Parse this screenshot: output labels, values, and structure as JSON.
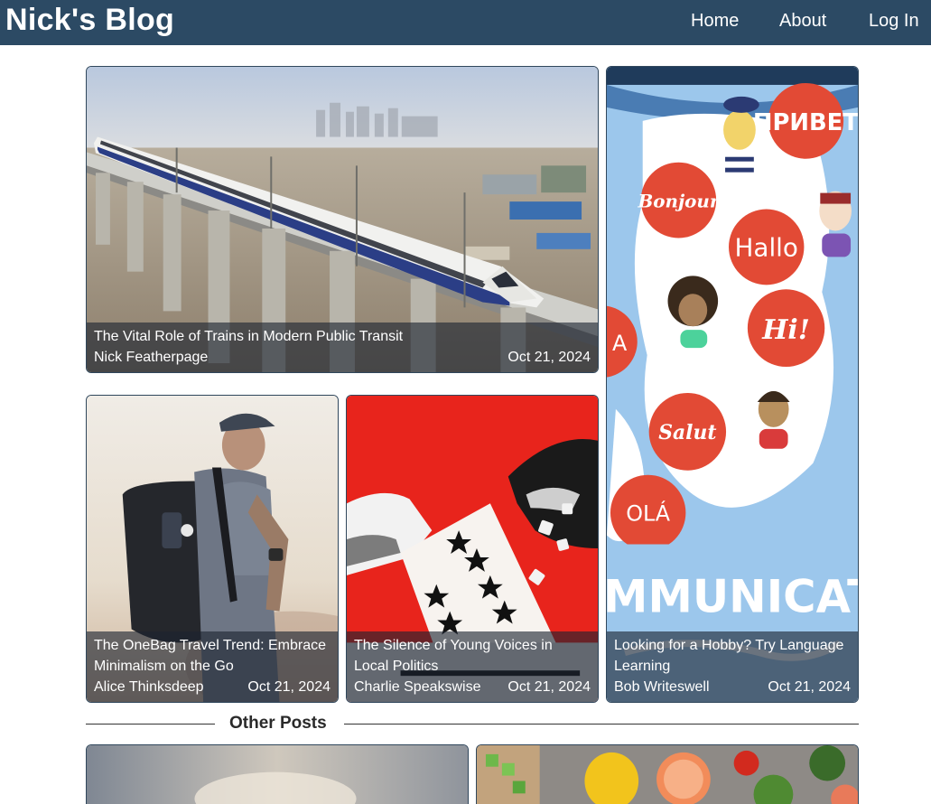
{
  "site": {
    "brand": "Nick's Blog"
  },
  "nav": {
    "home": "Home",
    "about": "About",
    "login": "Log In"
  },
  "featured": {
    "main": {
      "title": "The Vital Role of Trains in Modern Public Transit",
      "author": "Nick Featherpage",
      "date": "Oct 21, 2024"
    },
    "travel": {
      "title": "The OneBag Travel Trend: Embrace Minimalism on the Go",
      "author": "Alice Thinksdeep",
      "date": "Oct 21, 2024"
    },
    "politics": {
      "title": "The Silence of Young Voices in Local Politics",
      "author": "Charlie Speakswise",
      "date": "Oct 21, 2024"
    },
    "hobby": {
      "title": "Looking for a Hobby? Try Language Learning",
      "author": "Bob Writeswell",
      "date": "Oct 21, 2024"
    }
  },
  "other_posts": {
    "heading": "Other Posts"
  },
  "illustration": {
    "greetings": [
      "ПРИВЕТ",
      "Bonjour",
      "Hallo",
      "Hi!",
      "Salut",
      "OLÁ",
      "A"
    ],
    "banner": "MMUNICATIO"
  },
  "colors": {
    "nav_bg": "#2c4a64",
    "politics_red": "#e8241c",
    "map_blue": "#9cc7ec",
    "bubble_red": "#e24a35"
  }
}
